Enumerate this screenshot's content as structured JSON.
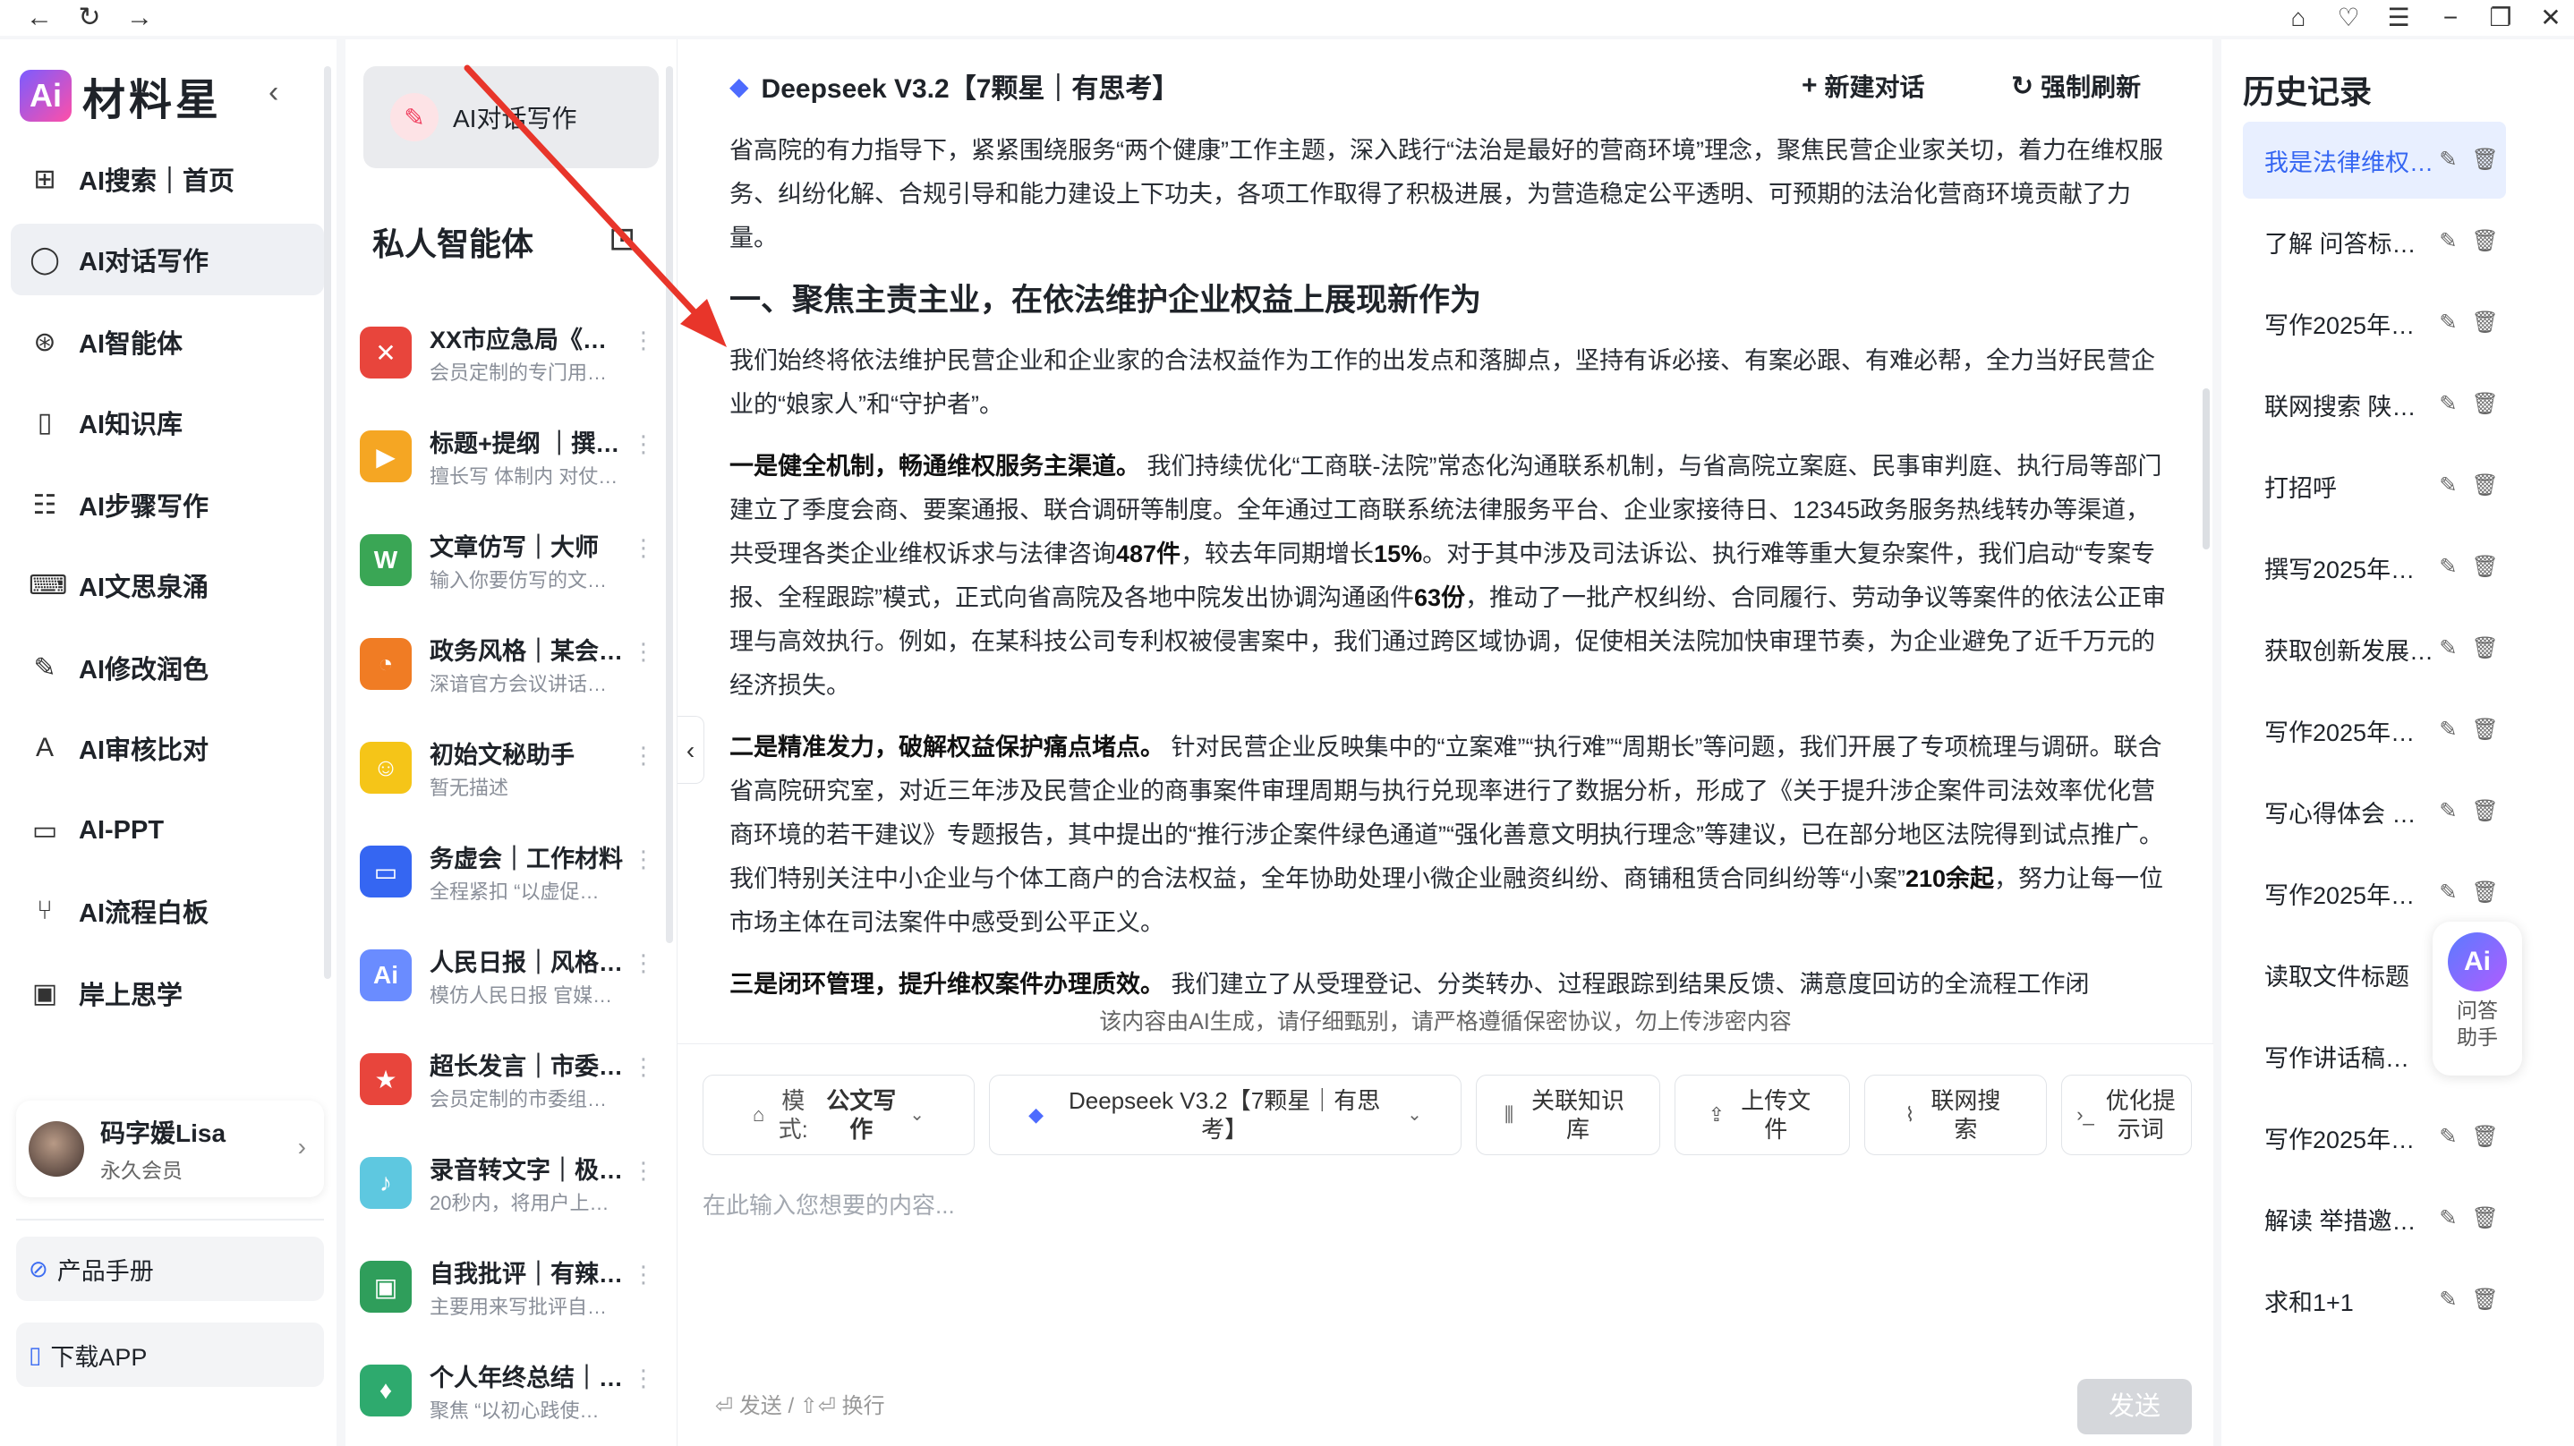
{
  "window": {
    "icons": {
      "back": "arrow-left-icon",
      "reload": "reload-icon",
      "forward": "arrow-right-icon",
      "home": "home-icon",
      "favorite": "heart-icon",
      "list": "list-icon",
      "minimize": "minimize-icon",
      "maximize": "maximize-icon",
      "close": "close-icon"
    }
  },
  "brand": {
    "mark": "Ai",
    "name": "材料星"
  },
  "nav": {
    "items": [
      {
        "label": "AI搜索｜首页",
        "icon": "grid-icon"
      },
      {
        "label": "AI对话写作",
        "icon": "chat-icon",
        "active": true
      },
      {
        "label": "AI智能体",
        "icon": "agent-icon"
      },
      {
        "label": "AI知识库",
        "icon": "book-icon"
      },
      {
        "label": "AI步骤写作",
        "icon": "steps-icon"
      },
      {
        "label": "AI文思泉涌",
        "icon": "keyboard-icon"
      },
      {
        "label": "AI修改润色",
        "icon": "pen-icon"
      },
      {
        "label": "AI审核比对",
        "icon": "translate-icon"
      },
      {
        "label": "AI-PPT",
        "icon": "presentation-icon"
      },
      {
        "label": "AI流程白板",
        "icon": "flow-icon"
      },
      {
        "label": "岸上思学",
        "icon": "video-icon"
      }
    ],
    "user": {
      "name": "码字媛Lisa",
      "level": "永久会员"
    },
    "bottom": [
      {
        "label": "产品手册",
        "icon": "manual-icon"
      },
      {
        "label": "下载APP",
        "icon": "phone-icon"
      }
    ]
  },
  "agents": {
    "write_button": "AI对话写作",
    "title": "私人智能体",
    "list": [
      {
        "name": "XX市应急局《专…",
        "desc": "会员定制的专门用…",
        "color": "#e8453c",
        "glyph": "✕"
      },
      {
        "name": "标题+提纲 ｜撰…",
        "desc": "擅长写 体制内 对仗…",
        "color": "#f5a623",
        "glyph": "▶"
      },
      {
        "name": "文章仿写｜大师",
        "desc": "输入你要仿写的文…",
        "color": "#3aa655",
        "glyph": "W"
      },
      {
        "name": "政务风格｜某会…",
        "desc": "深谙官方会议讲话…",
        "color": "#f07c24",
        "glyph": "◔"
      },
      {
        "name": "初始文秘助手",
        "desc": "暂无描述",
        "color": "#f5c518",
        "glyph": "☺"
      },
      {
        "name": "务虚会｜工作材料",
        "desc": "全程紧扣 “以虚促…",
        "color": "#3566f2",
        "glyph": "▭"
      },
      {
        "name": "人民日报｜风格…",
        "desc": "模仿人民日报 官媒…",
        "color": "#6a8cff",
        "glyph": "Ai"
      },
      {
        "name": "超长发言｜市委…",
        "desc": "会员定制的市委组…",
        "color": "#e8453c",
        "glyph": "★"
      },
      {
        "name": "录音转文字｜极…",
        "desc": "20秒内，将用户上…",
        "color": "#5ec8e0",
        "glyph": "♪"
      },
      {
        "name": "自我批评｜有辣…",
        "desc": "主要用来写批评自…",
        "color": "#2f9e5b",
        "glyph": "▣"
      },
      {
        "name": "个人年终总结｜…",
        "desc": "聚焦 “以初心践使…",
        "color": "#2eaa6e",
        "glyph": "♦"
      }
    ]
  },
  "main": {
    "model_title": "Deepseek V3.2【7颗星｜有思考】",
    "new_chat": "新建对话",
    "force_refresh": "强制刷新",
    "content": {
      "intro": "省高院的有力指导下，紧紧围绕服务“两个健康”工作主题，深入践行“法治是最好的营商环境”理念，聚焦民营企业家关切，着力在维权服务、纠纷化解、合规引导和能力建设上下功夫，各项工作取得了积极进展，为营造稳定公平透明、可预期的法治化营商环境贡献了力量。",
      "heading": "一、聚焦主责主业，在依法维护企业权益上展现新作为",
      "p1": "我们始终将依法维护民营企业和企业家的合法权益作为工作的出发点和落脚点，坚持有诉必接、有案必跟、有难必帮，全力当好民营企业的“娘家人”和“守护者”。",
      "p2_bold": "一是健全机制，畅通维权服务主渠道。",
      "p2_a": "我们持续优化“工商联-法院”常态化沟通联系机制，与省高院立案庭、民事审判庭、执行局等部门建立了季度会商、要案通报、联合调研等制度。全年通过工商联系统法律服务平台、企业家接待日、12345政务服务热线转办等渠道，共受理各类企业维权诉求与法律咨询",
      "p2_n1": "487件",
      "p2_b": "，较去年同期增长",
      "p2_n2": "15%",
      "p2_c": "。对于其中涉及司法诉讼、执行难等重大复杂案件，我们启动“专案专报、全程跟踪”模式，正式向省高院及各地中院发出协调沟通函件",
      "p2_n3": "63份",
      "p2_d": "，推动了一批产权纠纷、合同履行、劳动争议等案件的依法公正审理与高效执行。例如，在某科技公司专利权被侵害案中，我们通过跨区域协调，促使相关法院加快审理节奏，为企业避免了近千万元的经济损失。",
      "p3_bold": "二是精准发力，破解权益保护痛点堵点。",
      "p3_a": "针对民营企业反映集中的“立案难”“执行难”“周期长”等问题，我们开展了专项梳理与调研。联合省高院研究室，对近三年涉及民营企业的商事案件审理周期与执行兑现率进行了数据分析，形成了《关于提升涉企案件司法效率优化营商环境的若干建议》专题报告，其中提出的“推行涉企案件绿色通道”“强化善意文明执行理念”等建议，已在部分地区法院得到试点推广。我们特别关注中小企业与个体工商户的合法权益，全年协助处理小微企业融资纠纷、商铺租赁合同纠纷等“小案”",
      "p3_n1": "210余起",
      "p3_b": "，努力让每一位市场主体在司法案件中感受到公平正义。",
      "p4_bold": "三是闭环管理，提升维权案件办理质效。",
      "p4_a": "我们建立了从受理登记、分类转办、过程跟踪到结果反馈、满意度回访的全流程工作闭"
    },
    "disclaimer": "该内容由AI生成，请仔细甄别，请严格遵循保密协议，勿上传涉密内容",
    "toolbar": {
      "mode_key": "模式:",
      "mode_value": "公文写作",
      "model": "Deepseek V3.2【7颗星｜有思考】",
      "knowledge": "关联知识库",
      "upload": "上传文件",
      "web_search": "联网搜索",
      "optimize": "优化提示词"
    },
    "input_placeholder": "在此输入您想要的内容...",
    "hint": "发送 / ⇧⏎ 换行",
    "send": "发送"
  },
  "history": {
    "title": "历史记录",
    "items": [
      {
        "label": "我是法律维权…",
        "active": true
      },
      {
        "label": "了解 问答标…"
      },
      {
        "label": "写作2025年…"
      },
      {
        "label": "联网搜索 陕…"
      },
      {
        "label": "打招呼"
      },
      {
        "label": "撰写2025年…"
      },
      {
        "label": "获取创新发展…"
      },
      {
        "label": "写作2025年…"
      },
      {
        "label": "写心得体会 …"
      },
      {
        "label": "写作2025年…"
      },
      {
        "label": "读取文件标题"
      },
      {
        "label": "写作讲话稿…"
      },
      {
        "label": "写作2025年…"
      },
      {
        "label": "解读 举措邀…"
      },
      {
        "label": "求和1+1"
      }
    ]
  },
  "helper": {
    "logo": "Ai",
    "label": "问答助手"
  },
  "colors": {
    "accent": "#3566f2",
    "arrow": "#e8352a",
    "active_bg": "#e8efff"
  }
}
